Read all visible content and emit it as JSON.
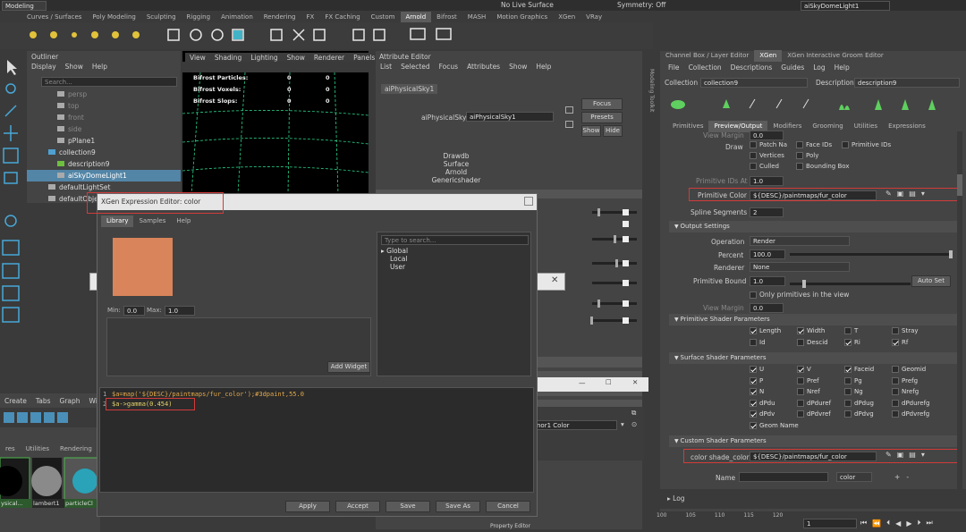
{
  "topbar": {
    "menu_left": "Modeling",
    "menu_mid": "No Live Surface",
    "menu_sym": "Symmetry: Off",
    "search_text": "aiSkyDomeLight1"
  },
  "shelf_tabs": [
    "Curves / Surfaces",
    "Poly Modeling",
    "Sculpting",
    "Rigging",
    "Animation",
    "Rendering",
    "FX",
    "FX Caching",
    "Custom",
    "Arnold",
    "Bifrost",
    "MASH",
    "Motion Graphics",
    "XGen",
    "VRay"
  ],
  "shelf_active": 9,
  "outliner": {
    "title": "Outliner",
    "menus": [
      "Display",
      "Show",
      "Help"
    ],
    "search_placeholder": "Search...",
    "items": [
      {
        "label": "persp",
        "indent": 1
      },
      {
        "label": "top",
        "indent": 1
      },
      {
        "label": "front",
        "indent": 1
      },
      {
        "label": "side",
        "indent": 1
      },
      {
        "label": "pPlane1",
        "indent": 1
      },
      {
        "label": "collection9",
        "indent": 0
      },
      {
        "label": "description9",
        "indent": 1
      },
      {
        "label": "aiSkyDomeLight1",
        "indent": 1
      },
      {
        "label": "defaultLightSet",
        "indent": 0
      },
      {
        "label": "defaultObjectSet",
        "indent": 0
      }
    ]
  },
  "viewport": {
    "menus": [
      "View",
      "Shading",
      "Lighting",
      "Show",
      "Renderer",
      "Panels"
    ],
    "stats": [
      {
        "label": "Bifrost Particles:",
        "a": "0",
        "b": "0"
      },
      {
        "label": "Bifrost Voxels:",
        "a": "0",
        "b": "0"
      },
      {
        "label": "Bifrost Slops:",
        "a": "0",
        "b": "0"
      }
    ]
  },
  "attribute_editor": {
    "title": "Attribute Editor",
    "menus": [
      "List",
      "Selected",
      "Focus",
      "Attributes",
      "Show",
      "Help"
    ],
    "tab": "aiPhysicalSky1",
    "field_label": "aiPhysicalSky:",
    "field_value": "aiPhysicalSky1",
    "focus": "Focus",
    "presets": "Presets",
    "show": "Show",
    "hide": "Hide",
    "list": [
      "Drawdb",
      "Surface",
      "Arnold",
      "Genericshader"
    ]
  },
  "expr_editor": {
    "title": "XGen Expression Editor: color",
    "tabs": [
      "Library",
      "Samples",
      "Help"
    ],
    "swatch_color": "#d9845a",
    "min_label": "Min:",
    "min_value": "0.0",
    "max_label": "Max:",
    "max_value": "1.0",
    "add_widget": "Add Widget",
    "lib_search": "Type to search...",
    "lib_items": [
      "Global",
      "Local",
      "User"
    ],
    "code_line1": "$a=map('${DESC}/paintmaps/fur_color');#3dpaint,55.0",
    "code_line2": "$a->gamma(0.454)",
    "buttons": [
      "Apply",
      "Accept",
      "Save",
      "Save As",
      "Cancel"
    ]
  },
  "hypershade": {
    "menus": [
      "Create",
      "Tabs",
      "Graph",
      "Wind"
    ],
    "tabs": [
      "res",
      "Utilities",
      "Rendering"
    ],
    "swatches": [
      "ysical...",
      "lambert1",
      "particleCl"
    ],
    "color_label": "nor1 Color"
  },
  "property_editor": "Property Editor",
  "right_panel": {
    "tabs_top": [
      "Channel Box / Layer Editor",
      "XGen",
      "XGen Interactive Groom Editor"
    ],
    "menus": [
      "File",
      "Collection",
      "Descriptions",
      "Guides",
      "Log",
      "Help"
    ],
    "collection_label": "Collection",
    "collection_value": "collection9",
    "description_label": "Description",
    "description_value": "description9",
    "toolbar": [
      "Modifiers",
      "Grooming",
      "Utilities"
    ],
    "subtabs": [
      "Primitives",
      "Preview/Output",
      "Modifiers",
      "Grooming",
      "Utilities",
      "Expressions"
    ],
    "subtab_active": 1,
    "side_label": "Modeling Toolkit",
    "view_margin_top": "View Margin",
    "view_margin_top_val": "0.0",
    "draw_label": "Draw",
    "draw_checks": [
      {
        "label": "Patch Na",
        "on": false
      },
      {
        "label": "Face IDs",
        "on": false
      },
      {
        "label": "Primitive IDs",
        "on": false
      },
      {
        "label": "Vertices",
        "on": false
      },
      {
        "label": "Poly",
        "on": false
      },
      {
        "label": "Culled",
        "on": false
      },
      {
        "label": "Bounding Box",
        "on": false
      }
    ],
    "prim_ids_at": "Primitive IDs At",
    "prim_ids_val": "1.0",
    "primitive_color_label": "Primitive Color",
    "primitive_color_value": "${DESC}/paintmaps/fur_color",
    "spline_label": "Spline Segments",
    "spline_value": "2",
    "output_settings": "Output Settings",
    "operation_label": "Operation",
    "operation_value": "Render",
    "percent_label": "Percent",
    "percent_value": "100.0",
    "renderer_label": "Renderer",
    "renderer_value": "None",
    "prim_bound_label": "Primitive Bound",
    "prim_bound_value": "1.0",
    "auto_set": "Auto Set",
    "only_prims": "Only primitives in the view",
    "view_margin": "View Margin",
    "view_margin_val": "0.0",
    "prim_shader": "Primitive Shader Parameters",
    "prim_params": [
      {
        "label": "Length",
        "on": true
      },
      {
        "label": "Width",
        "on": true
      },
      {
        "label": "T",
        "on": false
      },
      {
        "label": "Stray",
        "on": false
      },
      {
        "label": "Id",
        "on": false
      },
      {
        "label": "Descid",
        "on": false
      },
      {
        "label": "Ri",
        "on": true
      },
      {
        "label": "Rf",
        "on": true
      }
    ],
    "surf_shader": "Surface Shader Parameters",
    "surf_params": [
      {
        "label": "U",
        "on": true
      },
      {
        "label": "V",
        "on": true
      },
      {
        "label": "Faceid",
        "on": true
      },
      {
        "label": "Geomid",
        "on": false
      },
      {
        "label": "P",
        "on": true
      },
      {
        "label": "Pref",
        "on": false
      },
      {
        "label": "Pg",
        "on": false
      },
      {
        "label": "Prefg",
        "on": false
      },
      {
        "label": "N",
        "on": true
      },
      {
        "label": "Nref",
        "on": false
      },
      {
        "label": "Ng",
        "on": false
      },
      {
        "label": "Nrefg",
        "on": false
      },
      {
        "label": "dPdu",
        "on": true
      },
      {
        "label": "dPduref",
        "on": false
      },
      {
        "label": "dPdug",
        "on": false
      },
      {
        "label": "dPdurefg",
        "on": false
      },
      {
        "label": "dPdv",
        "on": true
      },
      {
        "label": "dPdvref",
        "on": false
      },
      {
        "label": "dPdvg",
        "on": false
      },
      {
        "label": "dPdvrefg",
        "on": false
      },
      {
        "label": "Geom Name",
        "on": true
      }
    ],
    "custom_shader": "Custom Shader Parameters",
    "custom_label": "color shade_color",
    "custom_value": "${DESC}/paintmaps/fur_color",
    "name_label": "Name",
    "color_dropdown": "color",
    "log": "Log"
  },
  "timeline": {
    "ticks": [
      "100",
      "105",
      "110",
      "115",
      "120"
    ],
    "frame": "1"
  },
  "colors": {
    "highlight": "#5285a6",
    "red": "#d23b3b",
    "swatch": "#d9845a"
  }
}
